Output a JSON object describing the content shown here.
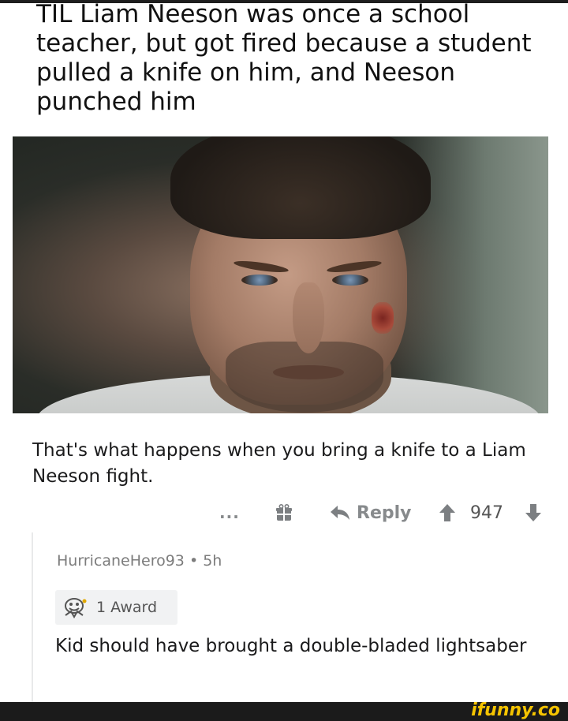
{
  "post": {
    "title": "TIL Liam Neeson was once a school teacher, but got fired because a student pulled a knife on him, and Neeson punched him"
  },
  "comment": {
    "text": "That's what happens when you bring a knife to a Liam Neeson fight.",
    "actions": {
      "more": "...",
      "reply_label": "Reply",
      "score": "947"
    }
  },
  "reply": {
    "username": "HurricaneHero93",
    "separator": "•",
    "age": "5h",
    "award_label": "1 Award",
    "text": "Kid should have brought a double-bladed lightsaber"
  },
  "watermark": {
    "brand": "ifunny.co"
  },
  "icons": {
    "gift": "gift-icon",
    "reply": "reply-arrow-icon",
    "upvote": "upvote-arrow-icon",
    "downvote": "downvote-arrow-icon",
    "award": "award-icon"
  },
  "colors": {
    "text": "#1a1a1b",
    "muted": "#878a8c",
    "brand": "#f5c400"
  }
}
